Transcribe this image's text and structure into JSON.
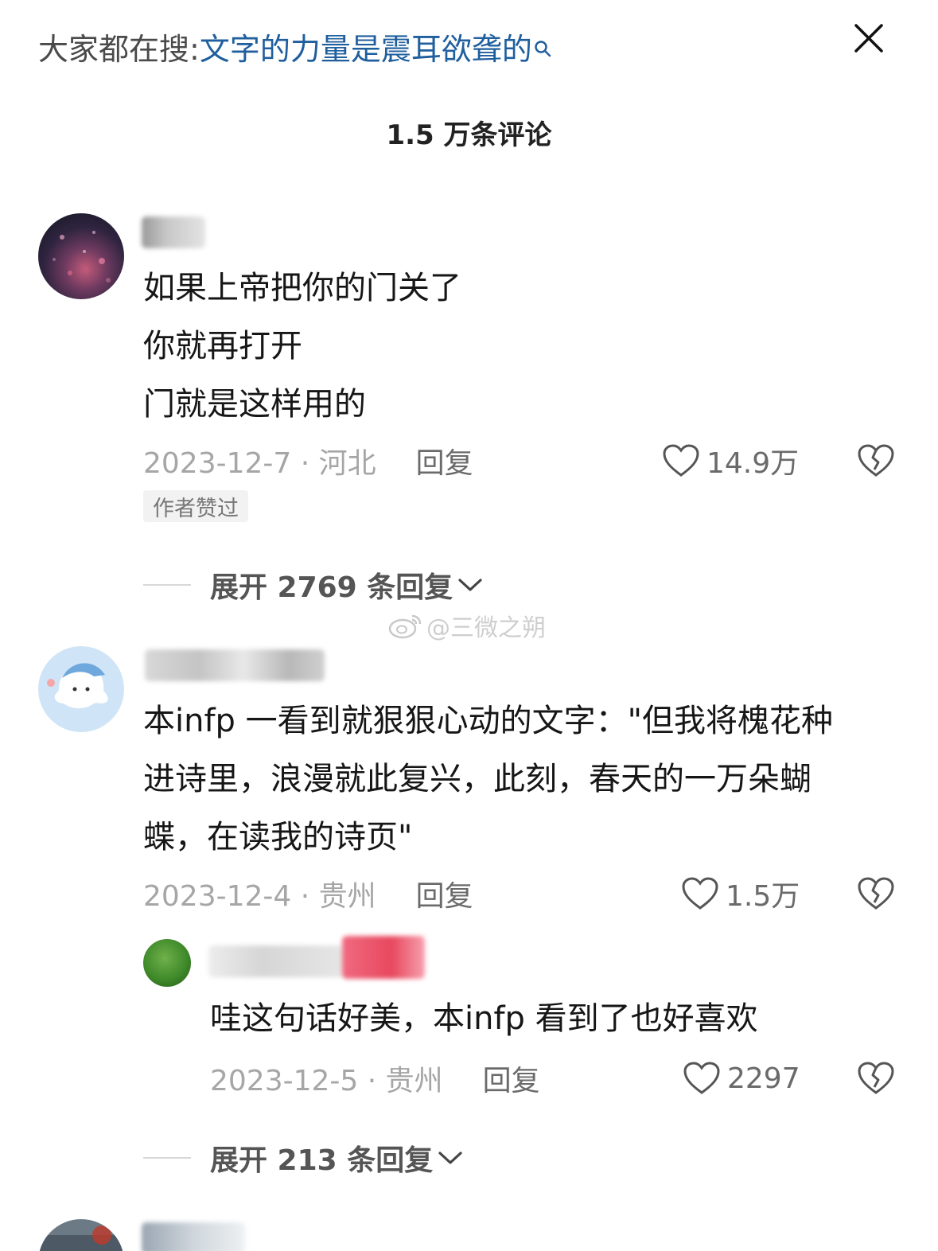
{
  "header": {
    "search_prefix": "大家都在搜:",
    "search_term": "文字的力量是震耳欲聋的",
    "comment_count": "1.5 万条评论"
  },
  "comments": [
    {
      "lines": [
        "如果上帝把你的门关了",
        "你就再打开",
        "门就是这样用的"
      ],
      "date_location": "2023-12-7 · 河北",
      "reply_label": "回复",
      "likes": "14.9万",
      "author_badge": "作者赞过",
      "expand_label": "展开 2769 条回复"
    },
    {
      "lines": [
        "本infp 一看到就狠狠心动的文字：\"但我将槐花种",
        "进诗里，浪漫就此复兴，此刻，春天的一万朵蝴",
        "蝶，在读我的诗页\""
      ],
      "date_location": "2023-12-4 · 贵州",
      "reply_label": "回复",
      "likes": "1.5万",
      "reply": {
        "text": "哇这句话好美，本infp 看到了也好喜欢",
        "date_location": "2023-12-5 · 贵州",
        "reply_label": "回复",
        "likes": "2297"
      },
      "expand_label": "展开 213 条回复"
    }
  ],
  "watermark": "@三微之朔",
  "colors": {
    "search_term": "#1f5f9e",
    "meta_gray": "#a6a6a6",
    "badge_bg": "#f2f2f2"
  },
  "icons": [
    "search-icon",
    "close-icon",
    "heart-icon",
    "broken-heart-icon",
    "chevron-down-icon",
    "weibo-icon"
  ]
}
